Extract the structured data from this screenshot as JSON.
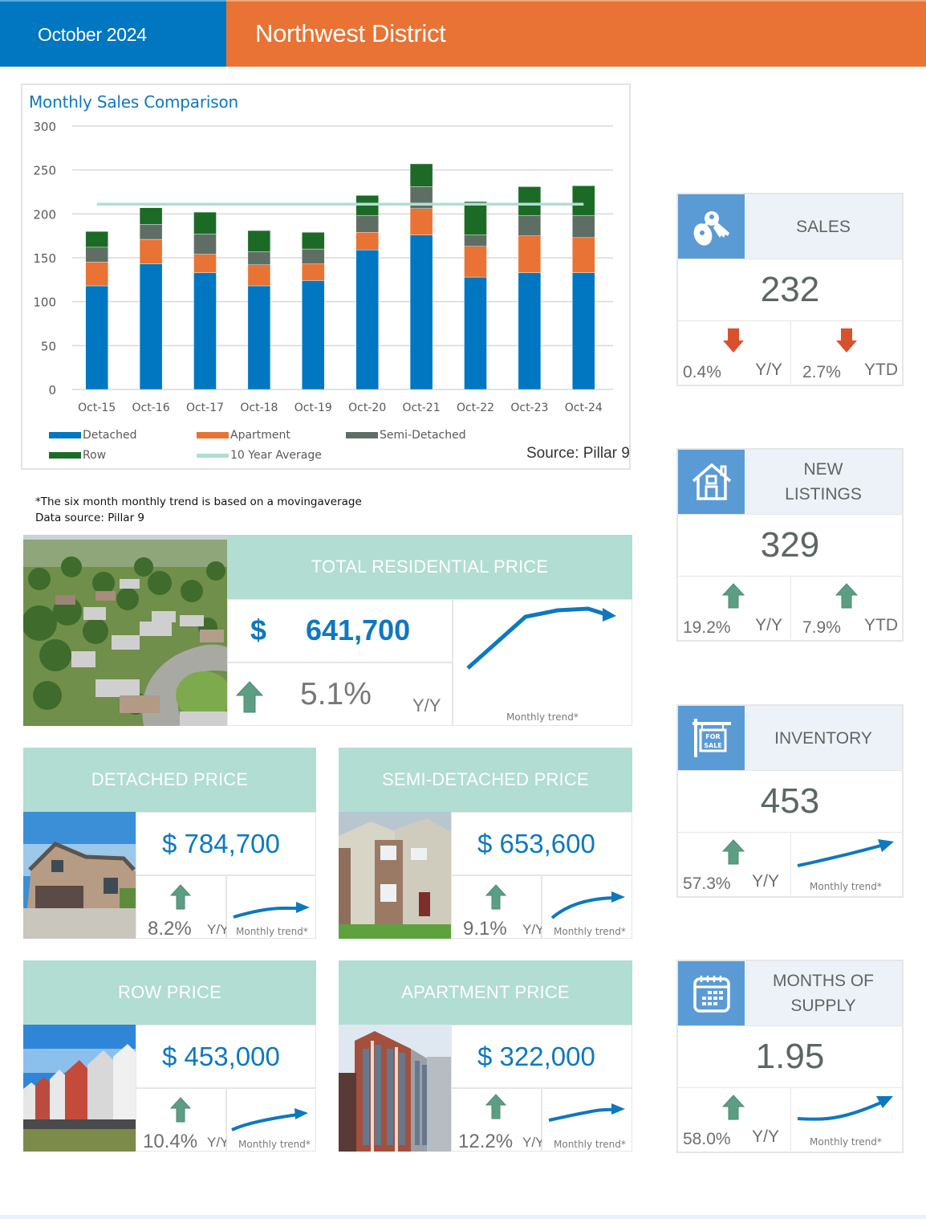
{
  "header": {
    "date": "October 2024",
    "district": "Northwest District",
    "colors": {
      "date_bg": "#0077c0",
      "district_bg": "#e87334"
    }
  },
  "chart_data": {
    "type": "bar",
    "stacked": true,
    "title": "Monthly Sales Comparison",
    "xlabel": "",
    "ylabel": "",
    "ylim": [
      0,
      300
    ],
    "yticks": [
      0,
      50,
      100,
      150,
      200,
      250,
      300
    ],
    "grid": true,
    "legend_position": "bottom",
    "categories": [
      "Oct-15",
      "Oct-16",
      "Oct-17",
      "Oct-18",
      "Oct-19",
      "Oct-20",
      "Oct-21",
      "Oct-22",
      "Oct-23",
      "Oct-24"
    ],
    "series": [
      {
        "name": "Detached",
        "color": "#0077c0",
        "values": [
          118,
          143,
          133,
          118,
          124,
          159,
          176,
          128,
          133,
          133
        ]
      },
      {
        "name": "Apartment",
        "color": "#e87334",
        "values": [
          27,
          28,
          21,
          24,
          19,
          20,
          30,
          35,
          42,
          40
        ]
      },
      {
        "name": "Semi-Detached",
        "color": "#5f6e65",
        "values": [
          17,
          17,
          23,
          15,
          17,
          19,
          25,
          13,
          23,
          25
        ]
      },
      {
        "name": "Row",
        "color": "#1b6b27",
        "values": [
          18,
          19,
          25,
          24,
          19,
          23,
          26,
          38,
          33,
          34
        ]
      }
    ],
    "lines": [
      {
        "name": "10 Year Average",
        "color": "#b1ddd2",
        "value": 211
      }
    ],
    "source": "Source: Pillar 9"
  },
  "footnote": {
    "line1": "*The six month monthly trend is based on a movingaverage",
    "line2": "Data source: Pillar 9"
  },
  "total_price": {
    "title": "TOTAL RESIDENTIAL PRICE",
    "currency": "$",
    "value": "641,700",
    "change": "5.1%",
    "change_direction": "up",
    "period": "Y/Y",
    "trend_label": "Monthly trend*",
    "trend_shape": "rise-then-flatten"
  },
  "price_cards": [
    {
      "id": "detached",
      "title": "DETACHED PRICE",
      "value": "$ 784,700",
      "change": "8.2%",
      "change_direction": "up",
      "period": "Y/Y",
      "trend_label": "Monthly trend*",
      "trend_shape": "gentle-rise"
    },
    {
      "id": "semi",
      "title": "SEMI-DETACHED PRICE",
      "value": "$ 653,600",
      "change": "9.1%",
      "change_direction": "up",
      "period": "Y/Y",
      "trend_label": "Monthly trend*",
      "trend_shape": "curve-rise"
    },
    {
      "id": "row",
      "title": "ROW PRICE",
      "value": "$ 453,000",
      "change": "10.4%",
      "change_direction": "up",
      "period": "Y/Y",
      "trend_label": "Monthly trend*",
      "trend_shape": "gentle-rise"
    },
    {
      "id": "apartment",
      "title": "APARTMENT PRICE",
      "value": "$ 322,000",
      "change": "12.2%",
      "change_direction": "up",
      "period": "Y/Y",
      "trend_label": "Monthly trend*",
      "trend_shape": "gentle-rise"
    }
  ],
  "kpis": [
    {
      "id": "sales",
      "icon": "keys-icon",
      "label": "SALES",
      "value": "232",
      "subs": [
        {
          "change": "0.4%",
          "direction": "down",
          "unit": "Y/Y"
        },
        {
          "change": "2.7%",
          "direction": "down",
          "unit": "YTD"
        }
      ]
    },
    {
      "id": "new-listings",
      "icon": "house-icon",
      "label": "NEW LISTINGS",
      "value": "329",
      "subs": [
        {
          "change": "19.2%",
          "direction": "up",
          "unit": "Y/Y"
        },
        {
          "change": "7.9%",
          "direction": "up",
          "unit": "YTD"
        }
      ]
    },
    {
      "id": "inventory",
      "icon": "for-sale-sign-icon",
      "label": "INVENTORY",
      "value": "453",
      "subs": [
        {
          "change": "57.3%",
          "direction": "up",
          "unit": "Y/Y"
        }
      ],
      "trend_label": "Monthly trend*",
      "trend_shape": "steady-rise"
    },
    {
      "id": "months-of-supply",
      "icon": "calendar-icon",
      "label": "MONTHS OF SUPPLY",
      "value": "1.95",
      "subs": [
        {
          "change": "58.0%",
          "direction": "up",
          "unit": "Y/Y"
        }
      ],
      "trend_label": "Monthly trend*",
      "trend_shape": "flat-then-rise"
    }
  ],
  "colors": {
    "accent": "#0e78bf",
    "card_header": "#b1ddd2",
    "up_arrow": "#5c9e84",
    "down_arrow": "#d9512c",
    "kpi_icon_bg": "#5b9bd5",
    "kpi_label_bg": "#edf2f9"
  }
}
